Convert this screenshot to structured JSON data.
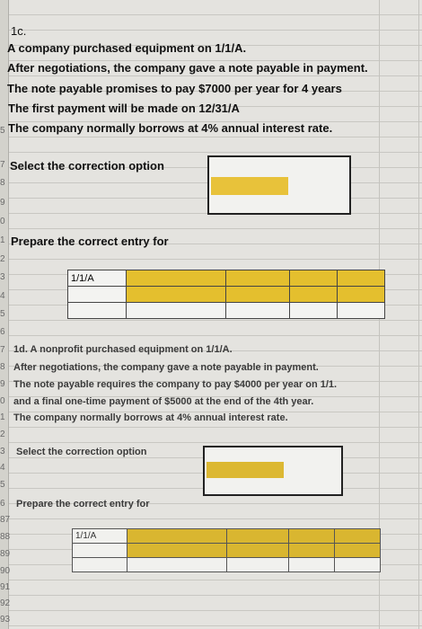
{
  "section1": {
    "id_label": "1c.",
    "lines": [
      "A company purchased equipment on 1/1/A.",
      "After negotiations, the company gave a note payable in payment.",
      "The note payable promises to pay $7000 per year for 4 years",
      "The first payment will be made on 12/31/A",
      "The company normally borrows at 4% annual interest rate."
    ],
    "select_label": "Select the correction option",
    "entry_label": "Prepare the correct entry for",
    "entry_date": "1/1/A"
  },
  "section2": {
    "lines": [
      "1d. A nonprofit purchased equipment on 1/1/A.",
      "After negotiations, the company gave a note payable in payment.",
      "The note payable requires the company to pay $4000 per year on 1/1.",
      "and a final one-time payment of $5000 at the end of the 4th year.",
      "The company normally borrows at 4% annual interest rate."
    ],
    "select_label": "Select the correction option",
    "entry_label": "Prepare the correct entry for",
    "entry_date": "1/1/A"
  },
  "row_numbers": [
    "5",
    "7",
    "8",
    "9",
    "0",
    "1",
    "2",
    "3",
    "4",
    "5",
    "6",
    "7",
    "8",
    "9",
    "0",
    "1",
    "2",
    "3",
    "4",
    "5",
    "6",
    "87",
    "88",
    "89",
    "90",
    "91",
    "92",
    "93"
  ],
  "colors": {
    "answer_fill": "#e8c23a",
    "cell_bg": "#f2f2ef"
  }
}
